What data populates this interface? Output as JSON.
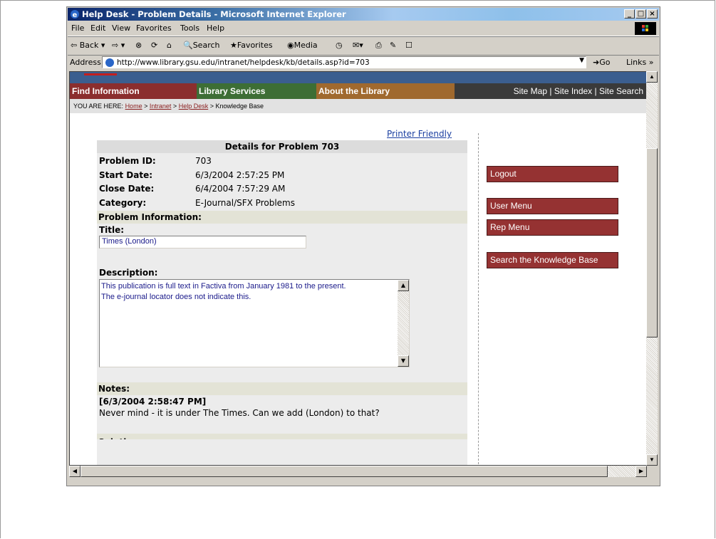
{
  "window": {
    "title": "Help Desk - Problem Details - Microsoft Internet Explorer",
    "controls": {
      "minimize": "_",
      "maximize": "□",
      "close": "×"
    }
  },
  "menubar": {
    "items": [
      {
        "label": "File"
      },
      {
        "label": "Edit"
      },
      {
        "label": "View"
      },
      {
        "label": "Favorites"
      },
      {
        "label": "Tools"
      },
      {
        "label": "Help"
      }
    ]
  },
  "toolbar": {
    "back": "Back",
    "search": "Search",
    "favorites": "Favorites",
    "media": "Media"
  },
  "address": {
    "label": "Address",
    "url": "http://www.library.gsu.edu/intranet/helpdesk/kb/details.asp?id=703",
    "go": "Go",
    "links": "Links"
  },
  "nav": {
    "find": "Find Information",
    "services": "Library Services",
    "about": "About the Library",
    "right_links": "Site Map  |  Site Index  |  Site Search",
    "colors": {
      "find": "#8b2e2e",
      "services": "#3d6e35",
      "about": "#a0692e",
      "rest": "#3a3a3a"
    }
  },
  "breadcrumb": {
    "prefix": "YOU ARE HERE:",
    "home": "Home",
    "intranet": "Intranet",
    "helpdesk": "Help Desk",
    "current": "Knowledge Base",
    "sep": ">"
  },
  "printer_friendly": "Printer Friendly",
  "details": {
    "heading": "Details for Problem 703",
    "fields": [
      {
        "label": "Problem ID:",
        "value": "703"
      },
      {
        "label": "Start Date:",
        "value": "6/3/2004 2:57:25 PM"
      },
      {
        "label": "Close Date:",
        "value": "6/4/2004 7:57:29 AM"
      },
      {
        "label": "Category:",
        "value": "E-Journal/SFX Problems"
      }
    ],
    "problem_info": "Problem Information:",
    "title_label": "Title:",
    "title_value": "Times (London)",
    "description_label": "Description:",
    "description_value": "This publication is full text in Factiva from January 1981 to the present.\nThe e-journal locator does not indicate this.",
    "notes_label": "Notes:",
    "note_time": "[6/3/2004 2:58:47 PM]",
    "note_text": "Never mind - it is under The Times. Can we add (London) to that?",
    "next_section_partial": "Solution"
  },
  "sidebar": {
    "logout": "Logout",
    "user_menu": "User Menu",
    "rep_menu": "Rep Menu",
    "search_kb": "Search the Knowledge Base"
  }
}
